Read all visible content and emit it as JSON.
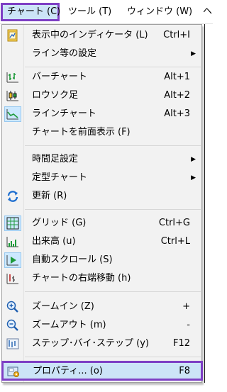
{
  "menubar": {
    "items": [
      {
        "label": "チャート (C)"
      },
      {
        "label": "ツール (T)"
      },
      {
        "label": "ウィンドウ (W)"
      },
      {
        "label": "ヘ"
      }
    ]
  },
  "menu": {
    "items": [
      {
        "label": "表示中のインディケータ (L)",
        "shortcut": "Ctrl+I",
        "icon": "indicator-list-icon"
      },
      {
        "label": "ライン等の設定",
        "submenu": true
      },
      {
        "label": "バーチャート",
        "shortcut": "Alt+1",
        "icon": "bar-chart-icon"
      },
      {
        "label": "ロウソク足",
        "shortcut": "Alt+2",
        "icon": "candlestick-icon"
      },
      {
        "label": "ラインチャート",
        "shortcut": "Alt+3",
        "icon": "line-chart-icon",
        "checked": true
      },
      {
        "label": "チャートを前面表示 (F)"
      },
      {
        "label": "時間足設定",
        "submenu": true
      },
      {
        "label": "定型チャート",
        "submenu": true
      },
      {
        "label": "更新 (R)",
        "icon": "refresh-icon"
      },
      {
        "label": "グリッド (G)",
        "shortcut": "Ctrl+G",
        "icon": "grid-icon",
        "checked": true
      },
      {
        "label": "出来高 (u)",
        "shortcut": "Ctrl+L",
        "icon": "volume-icon"
      },
      {
        "label": "自動スクロール (S)",
        "icon": "auto-scroll-icon",
        "checked": true
      },
      {
        "label": "チャートの右端移動 (h)",
        "icon": "chart-shift-icon"
      },
      {
        "label": "ズームイン (Z)",
        "shortcut": "+",
        "icon": "zoom-in-icon"
      },
      {
        "label": "ズームアウト (m)",
        "shortcut": "-",
        "icon": "zoom-out-icon"
      },
      {
        "label": "ステップ･バイ･ステップ (y)",
        "shortcut": "F12",
        "icon": "step-by-step-icon"
      },
      {
        "label": "プロパティ... (o)",
        "shortcut": "F8",
        "icon": "properties-icon",
        "highlighted": true
      }
    ],
    "submenu_arrow": "▶"
  },
  "colors": {
    "highlight_border": "#7e3fc4",
    "highlight_fill": "#cce4f7",
    "menu_bg": "#f2f2f2"
  }
}
